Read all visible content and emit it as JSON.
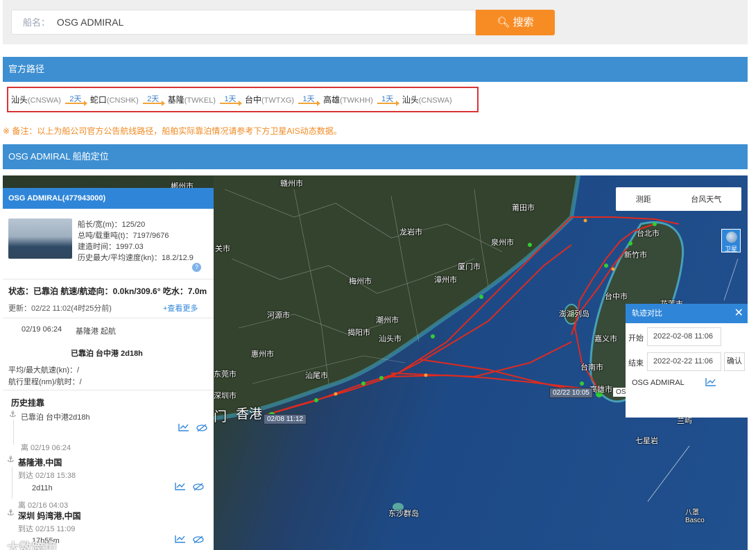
{
  "search": {
    "label": "船名：",
    "value": "OSG ADMIRAL",
    "button": "搜索"
  },
  "official_route": {
    "title": "官方路径",
    "ports": [
      {
        "name": "汕头",
        "code": "(CNSWA)"
      },
      {
        "name": "蛇口",
        "code": "(CNSHK)"
      },
      {
        "name": "基隆",
        "code": "(TWKEL)"
      },
      {
        "name": "台中",
        "code": "(TWTXG)"
      },
      {
        "name": "高雄",
        "code": "(TWKHH)"
      },
      {
        "name": "汕头",
        "code": "(CNSWA)"
      }
    ],
    "legs": [
      "2天",
      "2天",
      "1天",
      "1天",
      "1天"
    ],
    "note": "※ 备注：以上为船公司官方公告航线路径，船舶实际靠泊情况请参考下方卫星AIS动态数据。"
  },
  "positioning": {
    "title": "OSG ADMIRAL 船舶定位"
  },
  "ship_panel": {
    "header": "OSG ADMIRAL(477943000)",
    "specs": [
      "船长/宽(m)：125/20",
      "总吨/载重吨(t)：7197/9676",
      "建造时间：1997.03",
      "历史最大/平均速度(kn)：18.2/12.9"
    ],
    "status": "状态：已靠泊 航速/航迹向：0.0kn/309.6° 吃水：7.0m",
    "update": "更新：02/22 11:02(4时25分前)",
    "more_link": "+查看更多",
    "departure_time": "02/19 06:24",
    "departure_text": "基隆港 起航",
    "berthed": "已靠泊 台中港 2d18h",
    "avg_speed": "平均/最大航速(kn)：/",
    "mileage": "航行里程(nm)/航时：/",
    "history_title": "历史挂靠",
    "history": [
      {
        "top": "已靠泊 台中港2d18h",
        "leave": "离 02/19 06:24"
      },
      {
        "port": "基隆港,中国",
        "arrive": "到达 02/18 15:38",
        "stay": "2d11h",
        "leave": "离 02/16 04:03"
      },
      {
        "port": "深圳 妈湾港,中国",
        "arrive": "到达 02/15 11:09",
        "stay": "17h55m"
      }
    ]
  },
  "map": {
    "tools": [
      "测距",
      "台风天气"
    ],
    "satellite": "卫星",
    "cities": [
      "郴州市",
      "赣州市",
      "莆田市",
      "龙岩市",
      "泉州市",
      "关市",
      "厦门市",
      "漳州市",
      "梅州市",
      "河源市",
      "潮州市",
      "揭阳市",
      "汕头市",
      "惠州市",
      "东莞市",
      "深圳市",
      "汕尾市",
      "台北市",
      "新竹市",
      "台中市",
      "花莲市",
      "澎湖列岛",
      "嘉义市",
      "台南市",
      "高雄市",
      "兰屿",
      "七星岩",
      "东沙群岛",
      "八罩 Basco"
    ],
    "city_big": [
      "门",
      "香港"
    ],
    "time_tags": [
      "02/08 11:12",
      "02/22 10:05"
    ],
    "osg_tag": "OSG"
  },
  "track_compare": {
    "title": "轨迹对比",
    "start_label": "开始",
    "start_value": "2022-02-08 11:06",
    "end_label": "结束",
    "end_value": "2022-02-22 11:06",
    "confirm": "确认",
    "ship_name": "OSG ADMIRAL"
  },
  "watermark": "大数跨境"
}
